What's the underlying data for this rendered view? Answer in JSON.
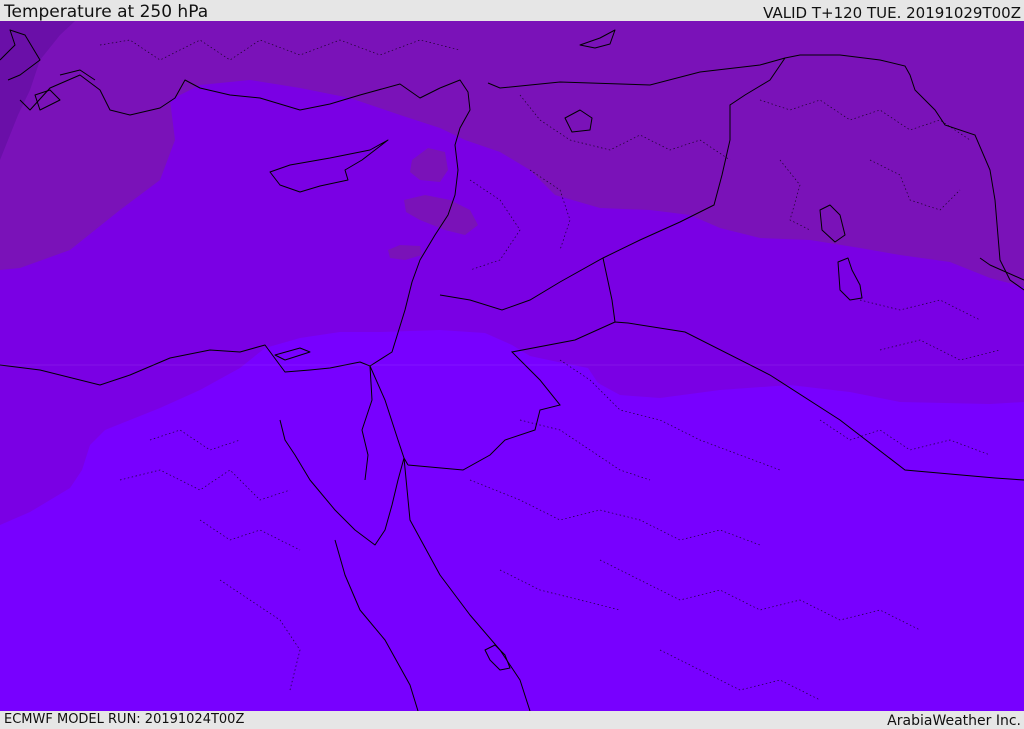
{
  "header": {
    "title": "Temperature at 250 hPa",
    "valid_time": "VALID T+120 TUE. 20191029T00Z"
  },
  "footer": {
    "model_run": "ECMWF MODEL RUN: 20191024T00Z",
    "credit": "ArabiaWeather Inc."
  },
  "map": {
    "colors": {
      "coldest": "#6a0fa8",
      "cold": "#7a12b8",
      "mid": "#7a00e4",
      "warm": "#7800ff",
      "line": "#000000"
    }
  }
}
